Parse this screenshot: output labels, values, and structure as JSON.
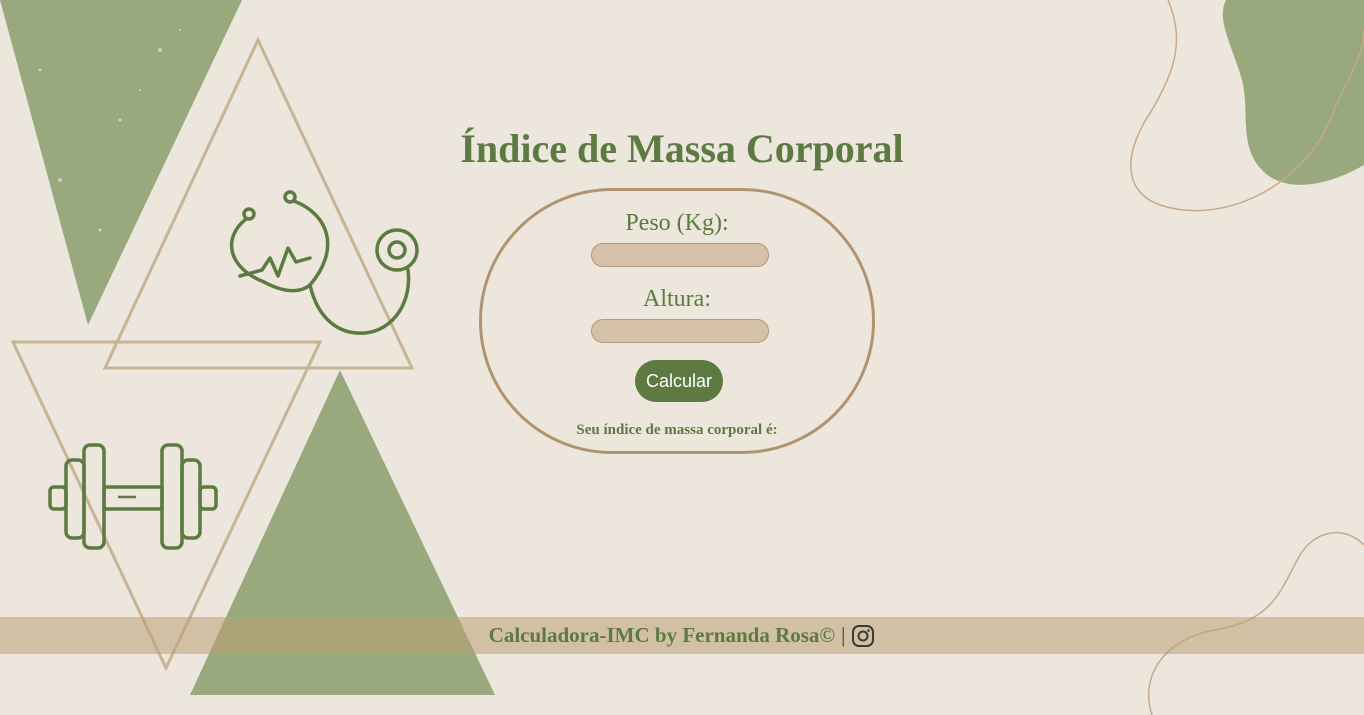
{
  "page": {
    "title": "Índice de Massa Corporal"
  },
  "form": {
    "weight_label": "Peso (Kg):",
    "weight_value": "",
    "height_label": "Altura:",
    "height_value": "",
    "submit_label": "Calcular",
    "result_text": "Seu índice de massa corporal é:"
  },
  "footer": {
    "credit": "Calculadora-IMC by Fernanda Rosa©",
    "separator": "|",
    "social_icon": "instagram-icon"
  },
  "decorations": {
    "icons": [
      "stethoscope-icon",
      "dumbbell-icon"
    ],
    "colors": {
      "background": "#ede6dc",
      "green": "#5c7a42",
      "sage": "#97a97d",
      "tan": "#b09470",
      "input": "#d6c2a8",
      "footer_band": "#c9b08b"
    }
  }
}
